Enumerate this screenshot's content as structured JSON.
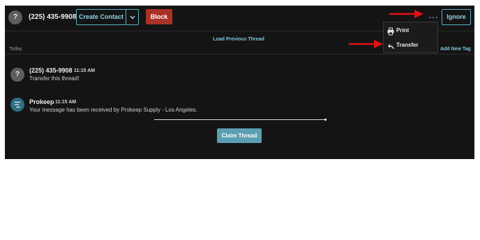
{
  "header": {
    "avatar_glyph": "?",
    "phone": "(225) 435-9908",
    "create_contact_label": "Create Contact",
    "caret_icon": "chevron-down-icon",
    "block_label": "Block",
    "more_icon": "ellipsis-icon",
    "more_glyph": "···",
    "ignore_label": "Ignore"
  },
  "menu": {
    "items": [
      {
        "label": "Print",
        "icon": "printer-icon"
      },
      {
        "label": "Transfer",
        "icon": "reply-arrow-icon"
      }
    ]
  },
  "thread": {
    "load_previous_label": "Load Previous Thread",
    "date_label": "Today",
    "add_tag_label": "Add New Tag",
    "messages": [
      {
        "avatar_glyph": "?",
        "sender": "(225) 435-9908",
        "time": "11:15 AM",
        "body": "Transfer this thread!"
      },
      {
        "avatar_icon": "list-lines-icon",
        "sender": "Prokeep",
        "time": "11:15 AM",
        "body": "Your message has been received by Prokeep Supply - Los Angeles."
      }
    ],
    "claim_label": "Claim Thread"
  },
  "colors": {
    "background": "#141414",
    "accent": "#5ab0c7",
    "block": "#a93226",
    "claim": "#5b9fb3",
    "annotation_arrow": "#e01010"
  }
}
